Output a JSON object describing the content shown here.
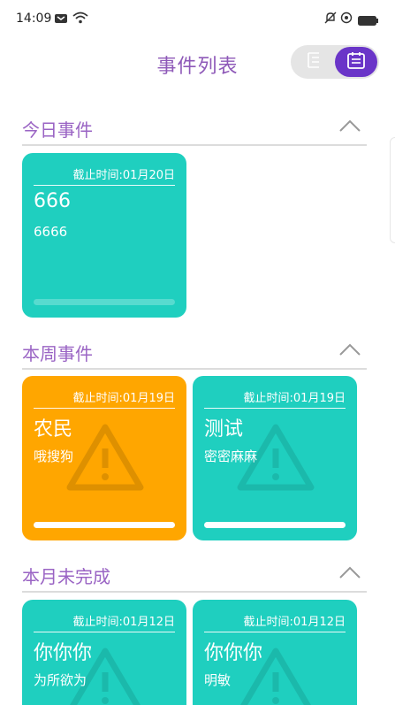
{
  "status_bar": {
    "time": "14:09"
  },
  "header": {
    "title": "事件列表",
    "toggle_options": [
      "list-view",
      "calendar-view"
    ],
    "active": "calendar-view"
  },
  "colors": {
    "accent": "#6a35c8",
    "title": "#8e59b8",
    "section": "#9a64c4",
    "teal": "#1fcfbf",
    "orange": "#ffa600"
  },
  "sections": [
    {
      "title": "今日事件",
      "cards": [
        {
          "deadline": "截止时间:01月20日",
          "title": "666",
          "desc": "6666",
          "color": "teal",
          "progress": 0
        }
      ]
    },
    {
      "title": "本周事件",
      "cards": [
        {
          "deadline": "截止时间:01月19日",
          "title": "农民",
          "desc": "哦搜狗",
          "color": "orange",
          "progress": 100
        },
        {
          "deadline": "截止时间:01月19日",
          "title": "测试",
          "desc": "密密麻麻",
          "color": "teal",
          "progress": 100
        }
      ]
    },
    {
      "title": "本月未完成",
      "cards": [
        {
          "deadline": "截止时间:01月12日",
          "title": "你你你",
          "desc": "为所欲为",
          "color": "teal",
          "progress": 100
        },
        {
          "deadline": "截止时间:01月12日",
          "title": "你你你",
          "desc": "明敏",
          "color": "teal",
          "progress": 100
        }
      ]
    }
  ]
}
